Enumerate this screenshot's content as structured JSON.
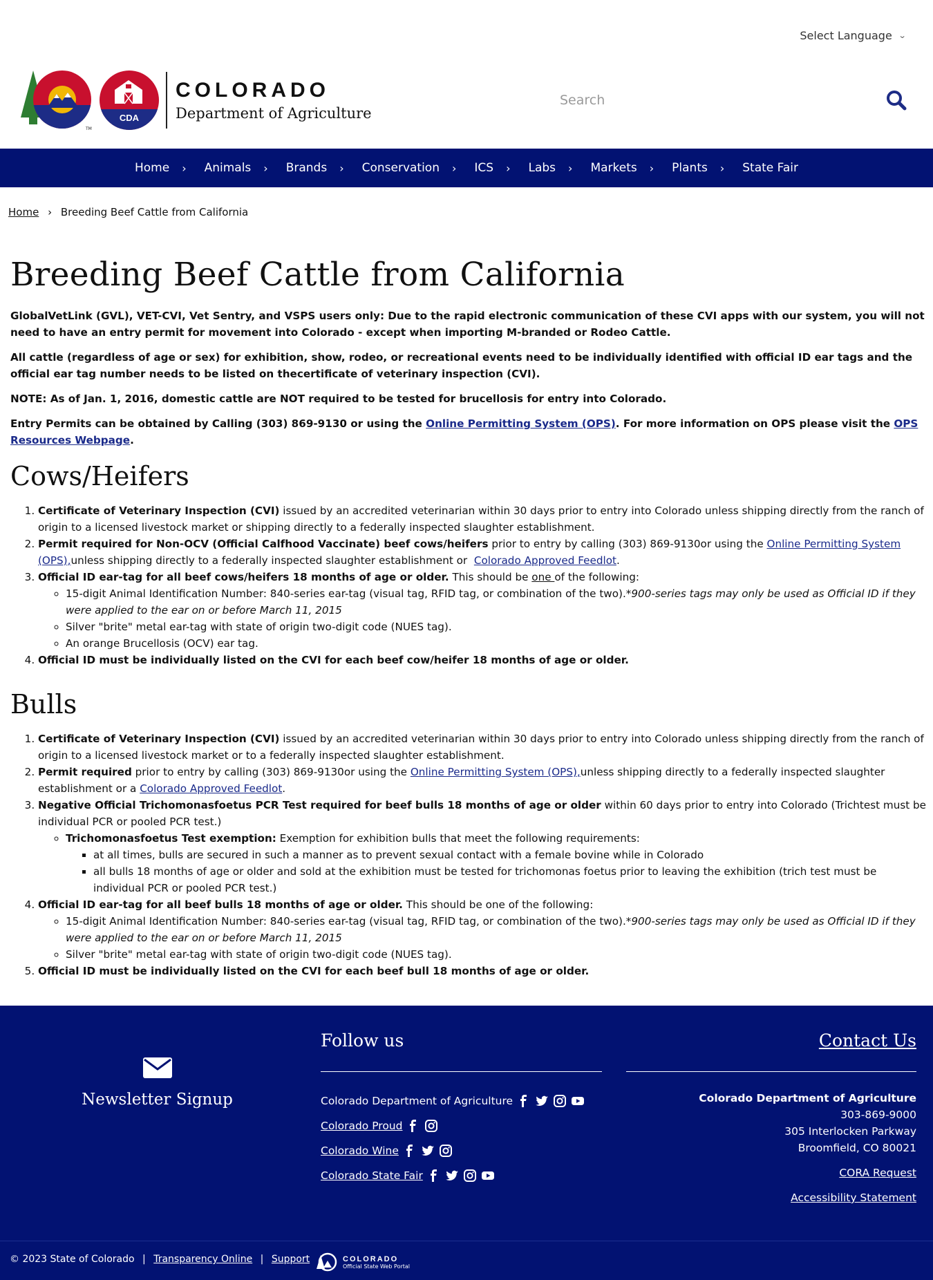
{
  "header": {
    "language_label": "Select Language",
    "logo_state": "COLORADO",
    "logo_dept": "Department of Agriculture",
    "logo_cda": "CDA",
    "search_placeholder": "Search"
  },
  "nav": {
    "items": [
      "Home",
      "Animals",
      "Brands",
      "Conservation",
      "ICS",
      "Labs",
      "Markets",
      "Plants",
      "State Fair"
    ]
  },
  "breadcrumb": {
    "home": "Home",
    "separator": "›",
    "current": "Breeding Beef Cattle from California"
  },
  "page": {
    "title": "Breeding Beef Cattle from California",
    "intro1": "GlobalVetLink (GVL), VET-CVI, Vet Sentry, and VSPS users only: Due to the rapid electronic communication of these CVI apps with our system, you will not need to have an entry permit for movement into Colorado - except when importing M-branded or Rodeo Cattle.",
    "intro2": "All cattle (regardless of age or sex) for exhibition, show, rodeo, or recreational events need to be individually identified with official ID ear tags and the official ear tag number needs to be listed on thecertificate of veterinary inspection (CVI).",
    "note": "NOTE: As of Jan. 1, 2016, domestic cattle are NOT required to be tested for brucellosis for entry into Colorado.",
    "permit_pre": "Entry Permits can be obtained by Calling (303) 869-9130 or using the ",
    "permit_link": "Online Permitting System (OPS)",
    "permit_mid": ". For more information on OPS please visit the ",
    "permit_link2": "OPS Resources Webpage",
    "permit_end": "."
  },
  "cows": {
    "heading": "Cows/Heifers",
    "i1_bold": "Certificate of Veterinary Inspection (CVI)",
    "i1_text": " issued by an accredited veterinarian within 30 days prior to entry into Colorado unless shipping directly from the ranch of origin to a licensed livestock market or shipping directly to a federally inspected slaughter establishment.",
    "i2_bold": "Permit required for Non-OCV (Official Calfhood Vaccinate) beef cows/heifers",
    "i2_text": " prior to entry by calling (303) 869-9130or using the ",
    "i2_link": "Online Permitting System (OPS),",
    "i2_text2": "unless shipping directly to a federally inspected slaughter establishment or  ",
    "i2_link2": "Colorado Approved Feedlot",
    "i2_end": ".",
    "i3_bold": "Official ID ear-tag for all beef cows/heifers 18 months of age or older.",
    "i3_text": " This should be ",
    "i3_u": "one ",
    "i3_text2": "of the following:",
    "i3_sub1": "15-digit Animal Identification Number: 840-series ear-tag (visual tag, RFID tag, or combination of the two).",
    "i3_sub1_i": "*900-series tags may only be used as Official ID if they were applied to the ear on or before March 11, 2015",
    "i3_sub2": "Silver \"brite\" metal ear-tag with state of origin two-digit code (NUES tag).",
    "i3_sub3": "An orange Brucellosis (OCV) ear tag.",
    "i4_bold": "Official ID must be individually listed on the CVI for each beef cow/heifer 18 months of age or older."
  },
  "bulls": {
    "heading": "Bulls",
    "i1_bold": "Certificate of Veterinary Inspection (CVI)",
    "i1_text": " issued by an accredited veterinarian within 30 days prior to entry into Colorado unless shipping directly from the ranch of origin to a licensed livestock market or to a federally inspected slaughter establishment.",
    "i2_bold": "Permit required",
    "i2_text": " prior to entry by calling (303) 869-9130or using the ",
    "i2_link": "Online Permitting System (OPS),",
    "i2_text2": "unless shipping directly to a federally inspected slaughter establishment or a ",
    "i2_link2": "Colorado Approved Feedlot",
    "i2_end": ".",
    "i3_bold": "Negative Official Trichomonasfoetus PCR Test required for beef bulls 18 months of age or older",
    "i3_text": " within 60 days prior to entry into Colorado (Trichtest must be individual PCR or pooled PCR test.)",
    "i3_sub_bold": "Trichomonasfoetus Test exemption:",
    "i3_sub_text": " Exemption for exhibition bulls that meet the following requirements:",
    "i3_sub_sub1": "at all times, bulls are secured in such a manner as to prevent sexual contact with a female bovine while in Colorado",
    "i3_sub_sub2": "all bulls 18 months of age or older and sold at the exhibition must be tested for trichomonas foetus prior to leaving the exhibition (trich test must be individual PCR or pooled PCR test.)",
    "i4_bold": "Official ID ear-tag for all beef bulls 18 months of age or older.",
    "i4_text": " This should be one of the following:",
    "i4_sub1": "15-digit Animal Identification Number: 840-series ear-tag (visual tag, RFID tag, or combination of the two).",
    "i4_sub1_i": "*900-series tags may only be used as Official ID if they were applied to the ear on or before March 11, 2015",
    "i4_sub2": "Silver \"brite\" metal ear-tag with state of origin two-digit code (NUES tag).",
    "i5_bold": "Official ID must be individually listed on the CVI for each beef bull 18 months of age or older."
  },
  "footer": {
    "newsletter": "Newsletter Signup",
    "follow_heading": "Follow us",
    "follow_items": [
      "Colorado Department of Agriculture",
      "Colorado Proud",
      "Colorado Wine",
      "Colorado State Fair"
    ],
    "contact_heading": "Contact Us",
    "org": "Colorado Department of Agriculture",
    "phone": "303-869-9000",
    "address1": "305 Interlocken Parkway",
    "address2": "Broomfield, CO 80021",
    "cora": "CORA Request",
    "accessibility": "Accessibility Statement",
    "copyright": "© 2023 State of Colorado",
    "transparency": "Transparency Online",
    "support": "Support",
    "pipe": "|",
    "portal_title": "COLORADO",
    "portal_sub": "Official State Web Portal"
  },
  "colors": {
    "nav_bg": "#021272",
    "link": "#1a2a8a",
    "logo_red": "#c8102e",
    "logo_blue": "#1d2c86",
    "logo_green": "#2e7d32",
    "logo_gold": "#f2b705"
  }
}
